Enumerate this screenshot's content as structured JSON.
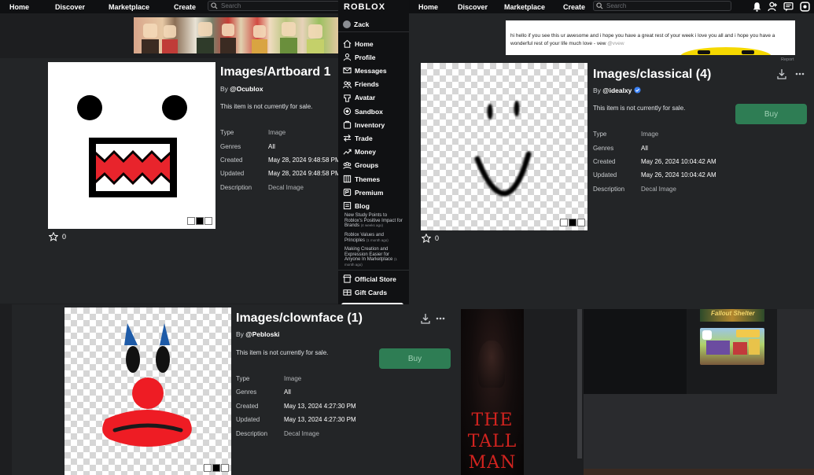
{
  "nav_left": {
    "home": "Home",
    "discover": "Discover",
    "marketplace": "Marketplace",
    "create": "Create",
    "search_placeholder": "Search"
  },
  "nav_right": {
    "home": "Home",
    "discover": "Discover",
    "marketplace": "Marketplace",
    "create": "Create",
    "search_placeholder": "Search"
  },
  "sidebar": {
    "logo": "ROBLOX",
    "user": "Zack",
    "items": [
      {
        "label": "Home",
        "icon": "home-icon"
      },
      {
        "label": "Profile",
        "icon": "profile-icon"
      },
      {
        "label": "Messages",
        "icon": "messages-icon"
      },
      {
        "label": "Friends",
        "icon": "friends-icon"
      },
      {
        "label": "Avatar",
        "icon": "avatar-icon"
      },
      {
        "label": "Sandbox",
        "icon": "sandbox-icon"
      },
      {
        "label": "Inventory",
        "icon": "inventory-icon"
      },
      {
        "label": "Trade",
        "icon": "trade-icon"
      },
      {
        "label": "Money",
        "icon": "money-icon"
      },
      {
        "label": "Groups",
        "icon": "groups-icon"
      },
      {
        "label": "Themes",
        "icon": "themes-icon"
      },
      {
        "label": "Premium",
        "icon": "premium-icon"
      },
      {
        "label": "Blog",
        "icon": "blog-icon"
      }
    ],
    "blog_posts": [
      {
        "title": "New Study Points to Roblox's Positive Impact for Brands",
        "age": "(4 weeks ago)"
      },
      {
        "title": "Roblox Values and Principles",
        "age": "(1 month ago)"
      },
      {
        "title": "Making Creation and Expression Easier for Anyone In Marketplace",
        "age": "(1 month ago)"
      }
    ],
    "official_store": "Official Store",
    "gift_cards": "Gift Cards"
  },
  "ad": {
    "text": "hi hello if you see this ur awesome and i hope you  have a great rest of your week i love you all and i hope you have a wonderful rest of your life much love - vew",
    "handle": "@vvew",
    "report": "Report"
  },
  "labels": {
    "type": "Type",
    "genres": "Genres",
    "created": "Created",
    "updated": "Updated",
    "description": "Description"
  },
  "items": [
    {
      "title": "Images/Artboard 1",
      "by_prefix": "By",
      "creator": "@Ocublox",
      "sale_status": "This item is not currently for sale.",
      "type": "Image",
      "genres": "All",
      "created": "May 28, 2024 9:48:58 PM",
      "updated": "May 28, 2024 9:48:58 PM",
      "description": "Decal Image",
      "favorites": "0"
    },
    {
      "title": "Images/classical (4)",
      "by_prefix": "By",
      "creator": "@idealxy",
      "sale_status": "This item is not currently for sale.",
      "buy_label": "Buy",
      "type": "Image",
      "genres": "All",
      "created": "May 26, 2024 10:04:42 AM",
      "updated": "May 26, 2024 10:04:42 AM",
      "description": "Decal Image",
      "favorites": "0"
    },
    {
      "title": "Images/clownface (1)",
      "by_prefix": "By",
      "creator": "@Pebloski",
      "sale_status": "This item is not currently for sale.",
      "buy_label": "Buy",
      "type": "Image",
      "genres": "All",
      "created": "May 13, 2024 4:27:30 PM",
      "updated": "May 13, 2024 4:27:30 PM",
      "description": "Decal Image"
    }
  ],
  "games": {
    "fallout": "Fallout Shelter"
  },
  "poster": {
    "line1": "THE",
    "line2": "TALL",
    "line3": "MAN"
  },
  "colors": {
    "buy_green": "#2e7d54",
    "verified_blue": "#3b82f6",
    "panel_bg": "#232527",
    "nav_bg": "#0f1012"
  }
}
